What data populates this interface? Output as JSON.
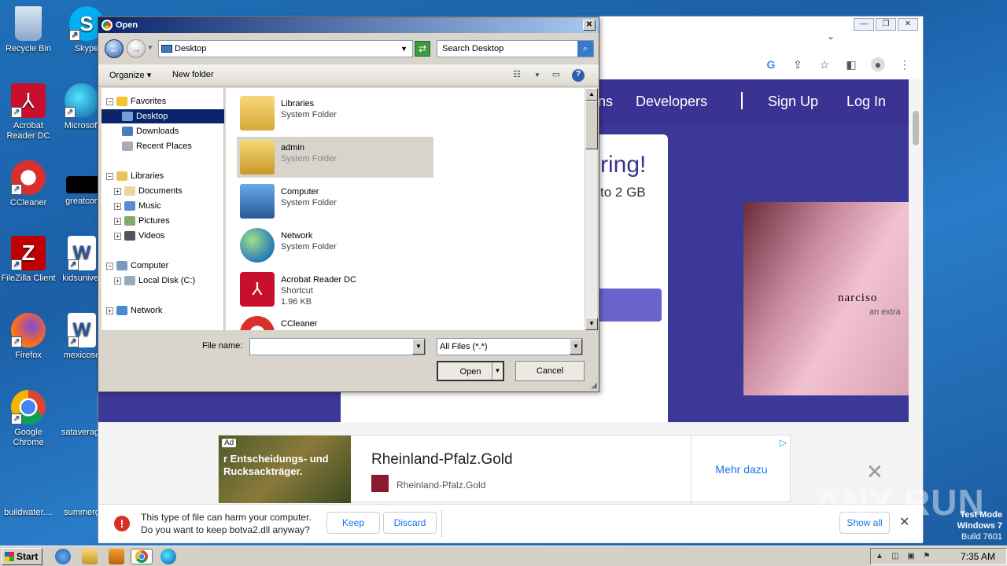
{
  "desktop": {
    "icons": [
      {
        "label": "Recycle Bin"
      },
      {
        "label": "Skype"
      },
      {
        "label": "Acrobat Reader DC"
      },
      {
        "label": "Microsoft"
      },
      {
        "label": "CCleaner"
      },
      {
        "label": "greatcom"
      },
      {
        "label": "FileZilla Client"
      },
      {
        "label": "kidsuniver"
      },
      {
        "label": "Firefox"
      },
      {
        "label": "mexicose"
      },
      {
        "label": "Google Chrome"
      },
      {
        "label": "sataverag"
      },
      {
        "label": "buildwater...."
      },
      {
        "label": "summerg"
      }
    ]
  },
  "browser": {
    "nav": {
      "developers": "Developers",
      "sign_up": "Sign Up",
      "log_in": "Log In",
      "partial": "ns"
    },
    "hero_title": "ring!",
    "hero_sub": "to 2 GB",
    "promo": {
      "brand": "narciso",
      "sub": "an extra"
    },
    "ad": {
      "badge": "Ad",
      "image_text": "r Entscheidungs- und Rucksackträger.",
      "title": "Rheinland-Pfalz.Gold",
      "source": "Rheinland-Pfalz.Gold",
      "cta": "Mehr dazu"
    },
    "download_bar": {
      "line1": "This type of file can harm your computer.",
      "line2": "Do you want to keep botva2.dll anyway?",
      "keep": "Keep",
      "discard": "Discard",
      "show_all": "Show all"
    }
  },
  "dialog": {
    "title": "Open",
    "address": "Desktop",
    "search_placeholder": "Search Desktop",
    "organize": "Organize",
    "new_folder": "New folder",
    "nav": {
      "favorites": "Favorites",
      "desktop": "Desktop",
      "downloads": "Downloads",
      "recent": "Recent Places",
      "libraries": "Libraries",
      "documents": "Documents",
      "music": "Music",
      "pictures": "Pictures",
      "videos": "Videos",
      "computer": "Computer",
      "local_disk": "Local Disk (C:)",
      "network": "Network"
    },
    "files": [
      {
        "name": "Libraries",
        "type": "System Folder",
        "size": ""
      },
      {
        "name": "admin",
        "type": "System Folder",
        "size": ""
      },
      {
        "name": "Computer",
        "type": "System Folder",
        "size": ""
      },
      {
        "name": "Network",
        "type": "System Folder",
        "size": ""
      },
      {
        "name": "Acrobat Reader DC",
        "type": "Shortcut",
        "size": "1.96 KB"
      },
      {
        "name": "CCleaner",
        "type": "Shortcut",
        "size": ""
      }
    ],
    "file_name_label": "File name:",
    "file_name_value": "",
    "filter": "All Files (*.*)",
    "open": "Open",
    "cancel": "Cancel"
  },
  "taskbar": {
    "start": "Start",
    "time": "7:35 AM"
  },
  "overlay": {
    "watermark": "ANY RUN",
    "test_mode": "Test Mode",
    "os": "Windows 7",
    "build": "Build 7601"
  },
  "colors": {
    "site_purple": "#3b3394",
    "dialog_title": "#0a246a",
    "selected": "#0a246a"
  }
}
